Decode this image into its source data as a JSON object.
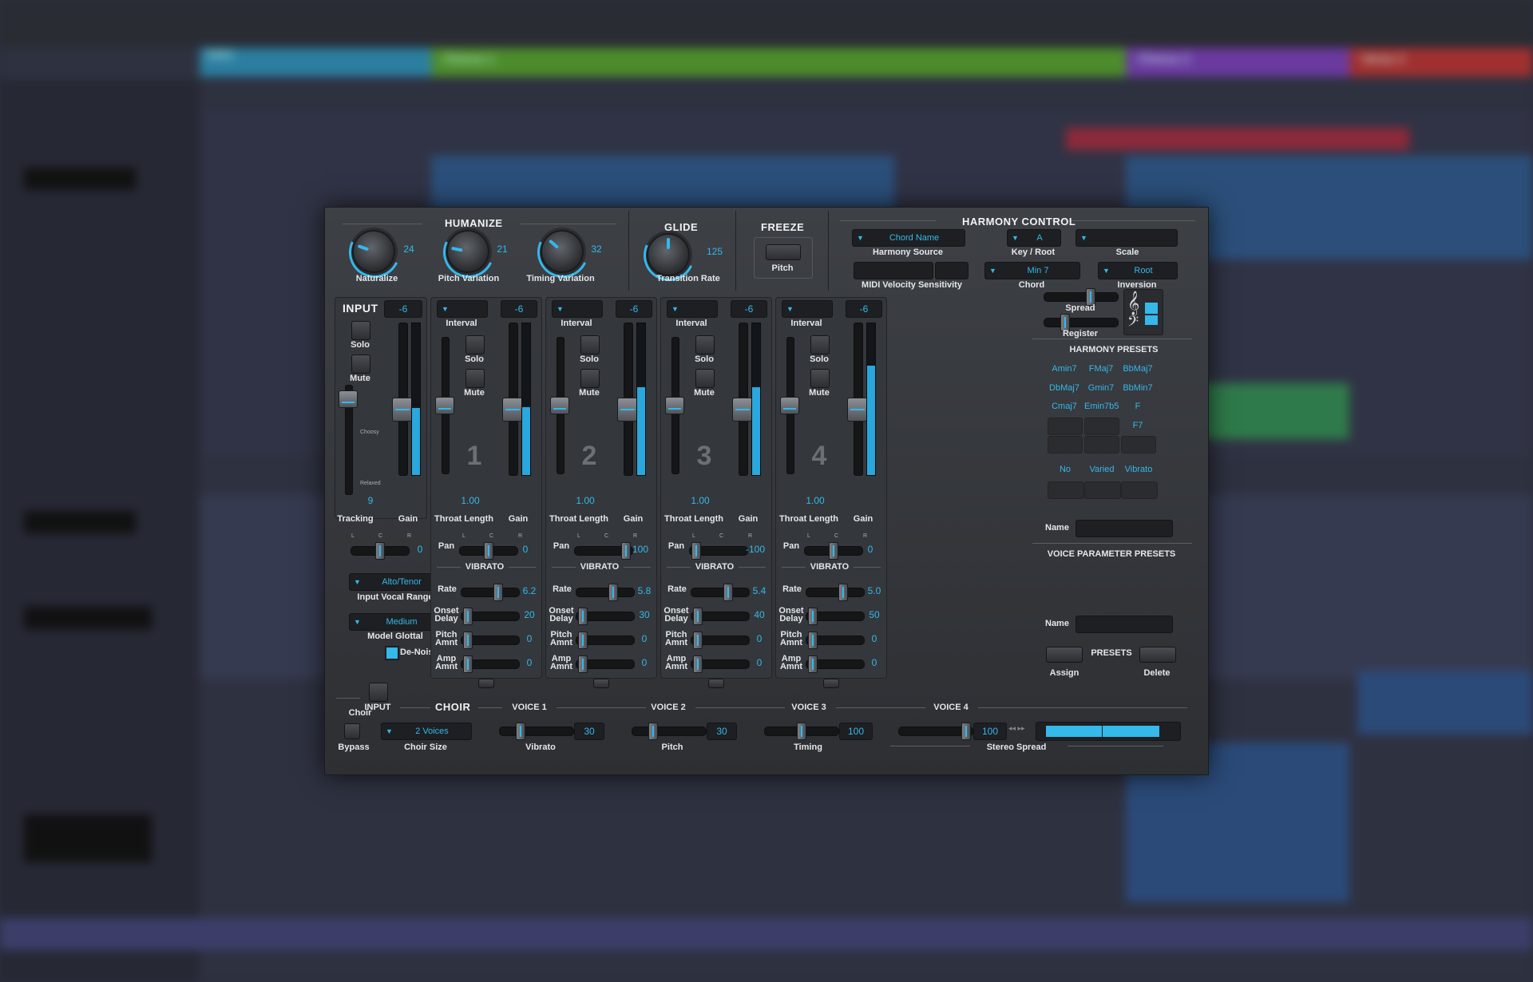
{
  "colors": {
    "accent": "#35b8ea",
    "panel": "#34373b"
  },
  "background": {
    "markers": [
      "Intro",
      "Chorus 1",
      "Chorus 2",
      "Verse 2"
    ]
  },
  "humanize": {
    "title": "HUMANIZE",
    "knobs": [
      {
        "label": "Naturalize",
        "value": "24",
        "level": 0.24
      },
      {
        "label": "Pitch Variation",
        "value": "21",
        "level": 0.21
      },
      {
        "label": "Timing Variation",
        "value": "32",
        "level": 0.32
      }
    ]
  },
  "glide": {
    "title": "GLIDE",
    "label": "Transition Rate",
    "value": "125",
    "level": 0.5
  },
  "freeze": {
    "title": "FREEZE",
    "label": "Pitch"
  },
  "harmony": {
    "title": "HARMONY CONTROL",
    "source": {
      "value": "Chord Name",
      "label": "Harmony Source"
    },
    "key": {
      "value": "A",
      "label": "Key / Root"
    },
    "scale": {
      "value": "",
      "label": "Scale"
    },
    "chord": {
      "value": "Min 7",
      "label": "Chord"
    },
    "inversion": {
      "value": "Root",
      "label": "Inversion"
    },
    "midi": "MIDI Velocity Sensitivity",
    "spread": "Spread",
    "register": "Register"
  },
  "input": {
    "title": "INPUT",
    "gain": "-6",
    "solo": "Solo",
    "mute": "Mute",
    "choosy": "Choosy",
    "relaxed": "Relaxed",
    "tracking_value": "9",
    "tracking": "Tracking",
    "gain_label": "Gain",
    "pan": "0",
    "pan_L": "L",
    "pan_C": "C",
    "pan_R": "R",
    "range": {
      "value": "Alto/Tenor",
      "label": "Input Vocal Range"
    },
    "glottal": {
      "value": "Medium",
      "label": "Model Glottal"
    },
    "denoise": "De-Noise"
  },
  "voices": [
    {
      "num": "1",
      "gain": "-6",
      "interval": "",
      "throat": "1.00",
      "pan": "0",
      "rate": "6.2",
      "onset": "20",
      "pitch": "0",
      "amp": "0",
      "gain_level": 0.45
    },
    {
      "num": "2",
      "gain": "-6",
      "interval": "",
      "throat": "1.00",
      "pan": "100",
      "rate": "5.8",
      "onset": "30",
      "pitch": "0",
      "amp": "0",
      "gain_level": 0.58
    },
    {
      "num": "3",
      "gain": "-6",
      "interval": "",
      "throat": "1.00",
      "pan": "-100",
      "rate": "5.4",
      "onset": "40",
      "pitch": "0",
      "amp": "0",
      "gain_level": 0.58
    },
    {
      "num": "4",
      "gain": "-6",
      "interval": "",
      "throat": "1.00",
      "pan": "0",
      "rate": "5.0",
      "onset": "50",
      "pitch": "0",
      "amp": "0",
      "gain_level": 0.72
    }
  ],
  "voice_labels": {
    "interval": "Interval",
    "solo": "Solo",
    "mute": "Mute",
    "throat": "Throat Length",
    "gain": "Gain",
    "pan": "Pan",
    "vibrato": "VIBRATO",
    "rate": "Rate",
    "onset": "Onset Delay",
    "pitch": "Pitch Amnt",
    "amp": "Amp Amnt",
    "L": "L",
    "C": "C",
    "R": "R"
  },
  "harmony_presets": {
    "title": "HARMONY PRESETS",
    "items": [
      "Amin7",
      "FMaj7",
      "BbMaj7",
      "DbMaj7",
      "Gmin7",
      "BbMin7",
      "Cmaj7",
      "Emin7b5",
      "F",
      "",
      "",
      "F7",
      "",
      "",
      ""
    ],
    "name": "Name"
  },
  "voice_presets": {
    "title": "VOICE PARAMETER PRESETS",
    "items": [
      "No Vari...",
      "Varied",
      "Vibrato",
      "",
      "",
      ""
    ],
    "name": "Name"
  },
  "presets": {
    "label": "PRESETS",
    "assign": "Assign",
    "delete": "Delete"
  },
  "choir": {
    "title": "CHOIR",
    "input": "INPUT",
    "choir_label": "Choir",
    "bypass": "Bypass",
    "size": {
      "value": "2 Voices",
      "label": "Choir Size"
    },
    "voice_heads": [
      "VOICE 1",
      "VOICE 2",
      "VOICE 3",
      "VOICE 4"
    ],
    "vibrato": {
      "value": "30",
      "label": "Vibrato"
    },
    "pitch": {
      "value": "30",
      "label": "Pitch"
    },
    "timing": {
      "value": "100",
      "label": "Timing"
    },
    "stereo": {
      "value": "100",
      "label": "Stereo Spread"
    }
  }
}
